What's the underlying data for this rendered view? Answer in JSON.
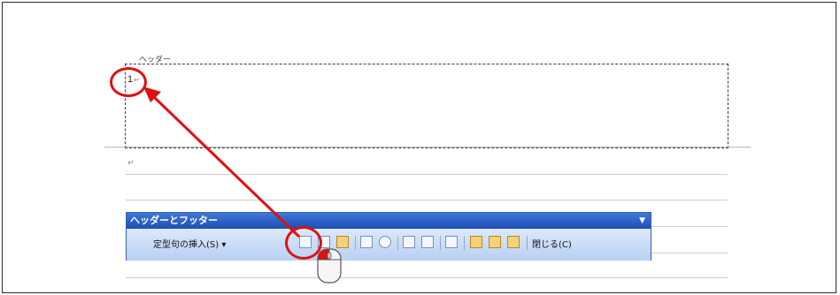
{
  "header": {
    "label": "ヘッダー",
    "page_number": "1",
    "paragraph_mark": "↵"
  },
  "body": {
    "paragraph_mark": "↵"
  },
  "toolbar": {
    "title": "ヘッダーとフッター",
    "insert_autotext_label": "定型句の挿入(S) ▾",
    "close_label": "閉じる(C)",
    "dropdown_icon": "▼"
  },
  "annotation": {
    "color": "#e01010"
  }
}
